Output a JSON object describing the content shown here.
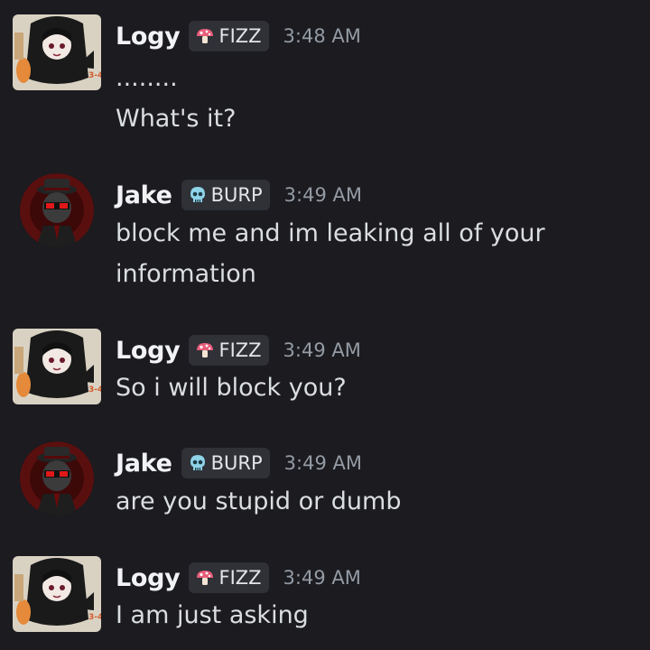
{
  "messages": [
    {
      "username": "Logy",
      "tag": "FIZZ",
      "tag_icon": "mushroom-icon",
      "time": "3:48 AM",
      "lines": [
        "........",
        "What's it?"
      ]
    },
    {
      "username": "Jake",
      "tag": "BURP",
      "tag_icon": "skull-icon",
      "time": "3:49 AM",
      "lines": [
        "block me and im leaking all of your",
        "information"
      ]
    },
    {
      "username": "Logy",
      "tag": "FIZZ",
      "tag_icon": "mushroom-icon",
      "time": "3:49 AM",
      "lines": [
        "So i will block you?"
      ]
    },
    {
      "username": "Jake",
      "tag": "BURP",
      "tag_icon": "skull-icon",
      "time": "3:49 AM",
      "lines": [
        "are you stupid or dumb"
      ]
    },
    {
      "username": "Logy",
      "tag": "FIZZ",
      "tag_icon": "mushroom-icon",
      "time": "3:49 AM",
      "lines": [
        "I am just asking"
      ]
    }
  ],
  "colors": {
    "background": "#1b1b20",
    "username": "#f2f3f5",
    "text": "#dbdee1",
    "timestamp": "#949ba4",
    "tag_bg": "#2f3137",
    "fizz_icon": "#e85d7a",
    "burp_icon": "#8fd3e8",
    "jake_eyes": "#e01818"
  }
}
